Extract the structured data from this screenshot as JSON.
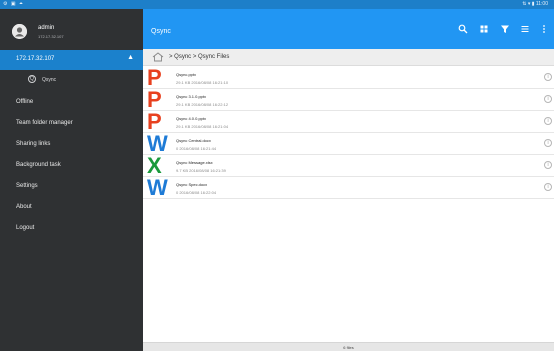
{
  "status_bar": {
    "left_icons": "⚙ ▣ ⏶",
    "right_text": "⇅ ▾ ▮ 11:00"
  },
  "sidebar": {
    "account": {
      "avatar_icon": "person-icon",
      "username": "admin",
      "ip": "172.17.32.107"
    },
    "server": {
      "label": "172.17.32.107",
      "caret": "▲"
    },
    "qsync": {
      "label": "Qsync"
    },
    "items": [
      {
        "label": "Offline"
      },
      {
        "label": "Team folder manager"
      },
      {
        "label": "Sharing links"
      },
      {
        "label": "Background task"
      },
      {
        "label": "Settings"
      },
      {
        "label": "About"
      },
      {
        "label": "Logout"
      }
    ]
  },
  "appbar": {
    "title": "Qsync",
    "icons": [
      "search-icon",
      "grid-icon",
      "filter-icon",
      "select-icon",
      "more-icon"
    ]
  },
  "breadcrumb": {
    "path": "> Qsync > Qsync Files"
  },
  "files": [
    {
      "letter": "P",
      "color": "#e8411f",
      "name": "Qsync.pptx",
      "meta": "29.1 KB  2016/08/08 16:21:10"
    },
    {
      "letter": "P",
      "color": "#e8411f",
      "name": "Qsync 3.1.0.pptx",
      "meta": "29.1 KB  2016/08/08 16:22:12"
    },
    {
      "letter": "P",
      "color": "#e8411f",
      "name": "Qsync 4.0.0.pptx",
      "meta": "29.1 KB  2016/08/08 16:21:04"
    },
    {
      "letter": "W",
      "color": "#1e7bd6",
      "name": "Qsync Central.docx",
      "meta": "0  2016/08/08 16:21:44"
    },
    {
      "letter": "X",
      "color": "#1a9a3c",
      "name": "Qsync Message.xlsx",
      "meta": "9.7 KB  2016/08/08 16:21:39"
    },
    {
      "letter": "W",
      "color": "#1e7bd6",
      "name": "Qsync Spec.docx",
      "meta": "0  2016/08/08 16:22:04"
    }
  ],
  "footer": {
    "count": "6 files"
  },
  "colors": {
    "accent": "#2196f3",
    "sidebar": "#2f3133",
    "selected": "#1b81cc"
  }
}
